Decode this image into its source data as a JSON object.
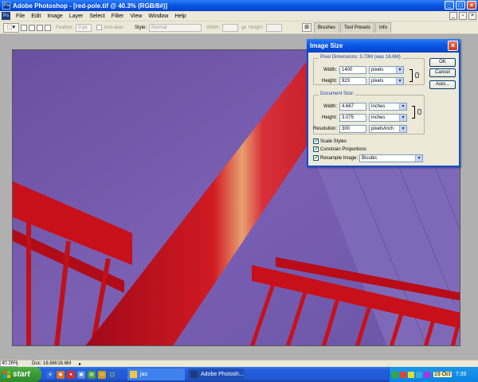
{
  "window": {
    "title": "Adobe Photoshop - [red-pole.tif @ 40.3% (RGB/8#)]",
    "app_icon": "photoshop-icon",
    "controls": [
      "minimize",
      "maximize",
      "close"
    ]
  },
  "menu": {
    "items": [
      "File",
      "Edit",
      "Image",
      "Layer",
      "Select",
      "Filter",
      "View",
      "Window",
      "Help"
    ]
  },
  "options_bar": {
    "feather_label": "Feather:",
    "feather_value": "0 px",
    "antialias_label": "Anti-alias",
    "style_label": "Style:",
    "style_value": "Normal",
    "width_label": "Width:",
    "height_label": "Height:"
  },
  "palette_well": {
    "tabs": [
      "Brushes",
      "Tool Presets",
      "Info"
    ]
  },
  "dialog": {
    "title": "Image Size",
    "pixel_dimensions_label": "Pixel Dimensions:  3.70M (was 16.6M)",
    "width_label": "Width:",
    "width_value": "1400",
    "width_unit": "pixels",
    "height_label": "Height:",
    "height_value": "923",
    "height_unit": "pixels",
    "document_size_label": "Document Size:",
    "doc_width_label": "Width:",
    "doc_width_value": "4.667",
    "doc_width_unit": "inches",
    "doc_height_label": "Height:",
    "doc_height_value": "3.075",
    "doc_height_unit": "inches",
    "resolution_label": "Resolution:",
    "resolution_value": "300",
    "resolution_unit": "pixels/inch",
    "scale_styles_label": "Scale Styles",
    "constrain_label": "Constrain Proportions",
    "resample_label": "Resample Image:",
    "resample_value": "Bicubic",
    "ok_label": "OK",
    "cancel_label": "Cancel",
    "auto_label": "Auto..."
  },
  "status": {
    "zoom": "40.26%",
    "doc": "Doc: 16.6M/16.6M"
  },
  "taskbar": {
    "start_label": "start",
    "buttons": [
      "jas",
      "Adobe Photosh..."
    ],
    "date": "19 Oct",
    "time": "7:39"
  },
  "colors": {
    "xp_blue": "#0a58e6",
    "photo_purple": "#6d54a6",
    "photo_red": "#c8101a",
    "start_green": "#3a9a35"
  }
}
